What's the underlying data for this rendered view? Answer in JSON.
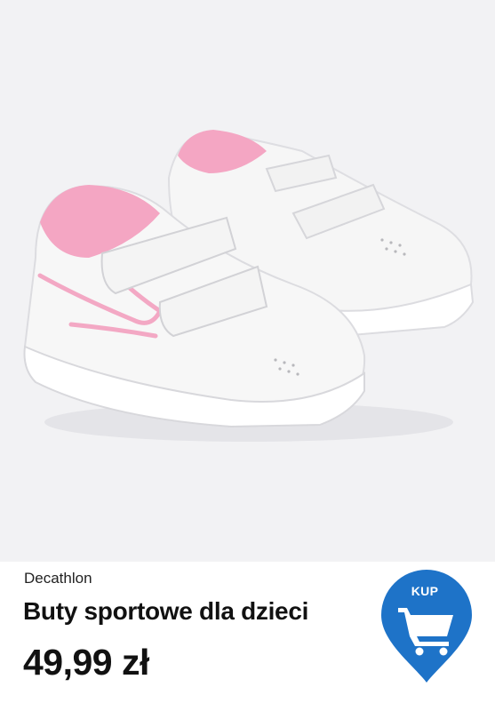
{
  "product": {
    "brand": "Decathlon",
    "name": "Buty sportowe dla dzieci",
    "price": "49,99 zł",
    "image_alt": "Białe dziecięce buty sportowe na rzepy z różowymi akcentami"
  },
  "buy_button": {
    "label": "KUP",
    "icon": "shopping-cart-icon",
    "color": "#1e73c8"
  },
  "colors": {
    "photo_background": "#f2f2f4",
    "shoe_white": "#f7f7f7",
    "accent_pink": "#f3a8c4"
  }
}
